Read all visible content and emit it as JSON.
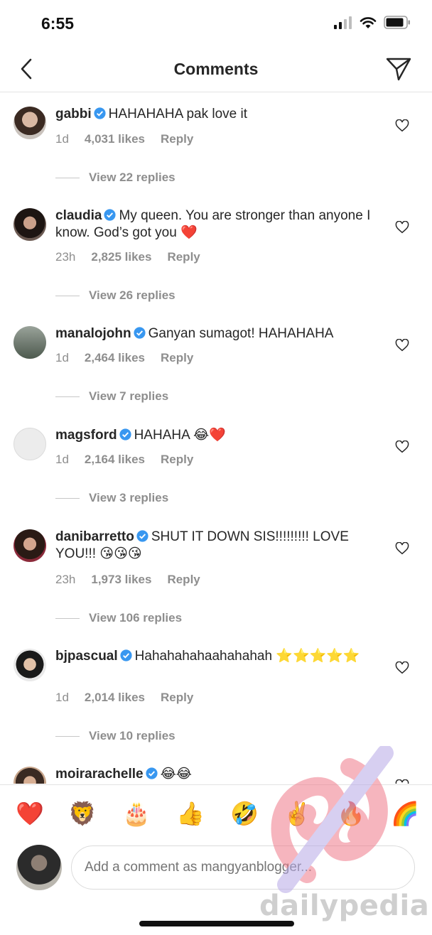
{
  "status_bar": {
    "time": "6:55"
  },
  "nav": {
    "title": "Comments"
  },
  "comments": [
    {
      "username": "gabbi",
      "verified": true,
      "text": "HAHAHAHA pak love it",
      "time": "1d",
      "likes": "4,031 likes",
      "reply": "Reply",
      "view_replies": "View 22 replies"
    },
    {
      "username": "claudia",
      "verified": true,
      "text": "My queen. You are stronger than anyone I know. God’s got you ❤️",
      "time": "23h",
      "likes": "2,825 likes",
      "reply": "Reply",
      "view_replies": "View 26 replies"
    },
    {
      "username": "manalojohn",
      "verified": true,
      "text": "Ganyan sumagot! HAHAHAHA",
      "time": "1d",
      "likes": "2,464 likes",
      "reply": "Reply",
      "view_replies": "View 7 replies"
    },
    {
      "username": "magsford",
      "verified": true,
      "text": "HAHAHA 😂❤️",
      "time": "1d",
      "likes": "2,164 likes",
      "reply": "Reply",
      "view_replies": "View 3 replies"
    },
    {
      "username": "danibarretto",
      "verified": true,
      "text": "SHUT IT DOWN SIS!!!!!!!!! LOVE YOU!!! 😘😘😘",
      "time": "23h",
      "likes": "1,973 likes",
      "reply": "Reply",
      "view_replies": "View 106 replies"
    },
    {
      "username": "bjpascual",
      "verified": true,
      "text": "Hahahahahaahahahah ⭐⭐⭐⭐⭐",
      "time": "1d",
      "likes": "2,014 likes",
      "reply": "Reply",
      "view_replies": "View 10 replies"
    },
    {
      "username": "moirarachelle",
      "verified": true,
      "text": "😂😂",
      "time": "",
      "likes": "",
      "reply": "",
      "view_replies": ""
    }
  ],
  "emoji_bar": [
    "❤️",
    "🦁",
    "🎂",
    "👍",
    "🤣",
    "✌️",
    "🔥",
    "🌈"
  ],
  "composer": {
    "placeholder": "Add a comment as mangyanblogger..."
  },
  "watermark": {
    "text": "dailypedia"
  },
  "colors": {
    "verified": "#3897f0",
    "meta": "#8e8e8e",
    "text": "#262626"
  },
  "icons": {
    "back": "chevron-left-icon",
    "send": "paper-plane-icon",
    "like": "heart-outline-icon",
    "verified": "verified-badge-icon"
  }
}
